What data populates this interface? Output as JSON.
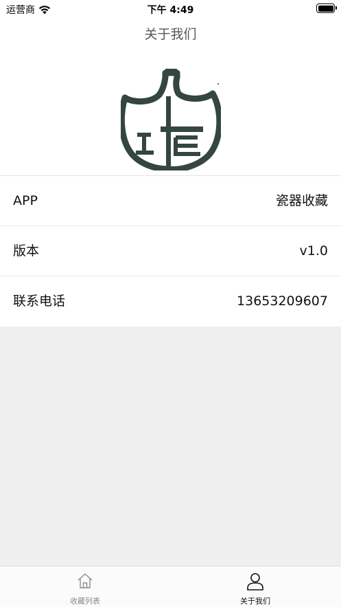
{
  "status_bar": {
    "carrier": "运营商",
    "time": "下午 4:49",
    "icons": [
      "wifi-icon",
      "battery-icon"
    ]
  },
  "nav": {
    "title": "关于我们"
  },
  "info_rows": [
    {
      "label": "APP",
      "value": "瓷器收藏"
    },
    {
      "label": "版本",
      "value": "v1.0"
    },
    {
      "label": "联系电话",
      "value": "13653209607"
    }
  ],
  "tab_bar": {
    "tabs": [
      {
        "label": "收藏列表",
        "icon": "home-icon",
        "selected": false
      },
      {
        "label": "关于我们",
        "icon": "user-icon",
        "selected": true
      }
    ]
  },
  "colors": {
    "background": "#efefef",
    "logo": "#34463e",
    "tab_selected": "#111111",
    "tab_unselected": "#8a8a8a"
  }
}
